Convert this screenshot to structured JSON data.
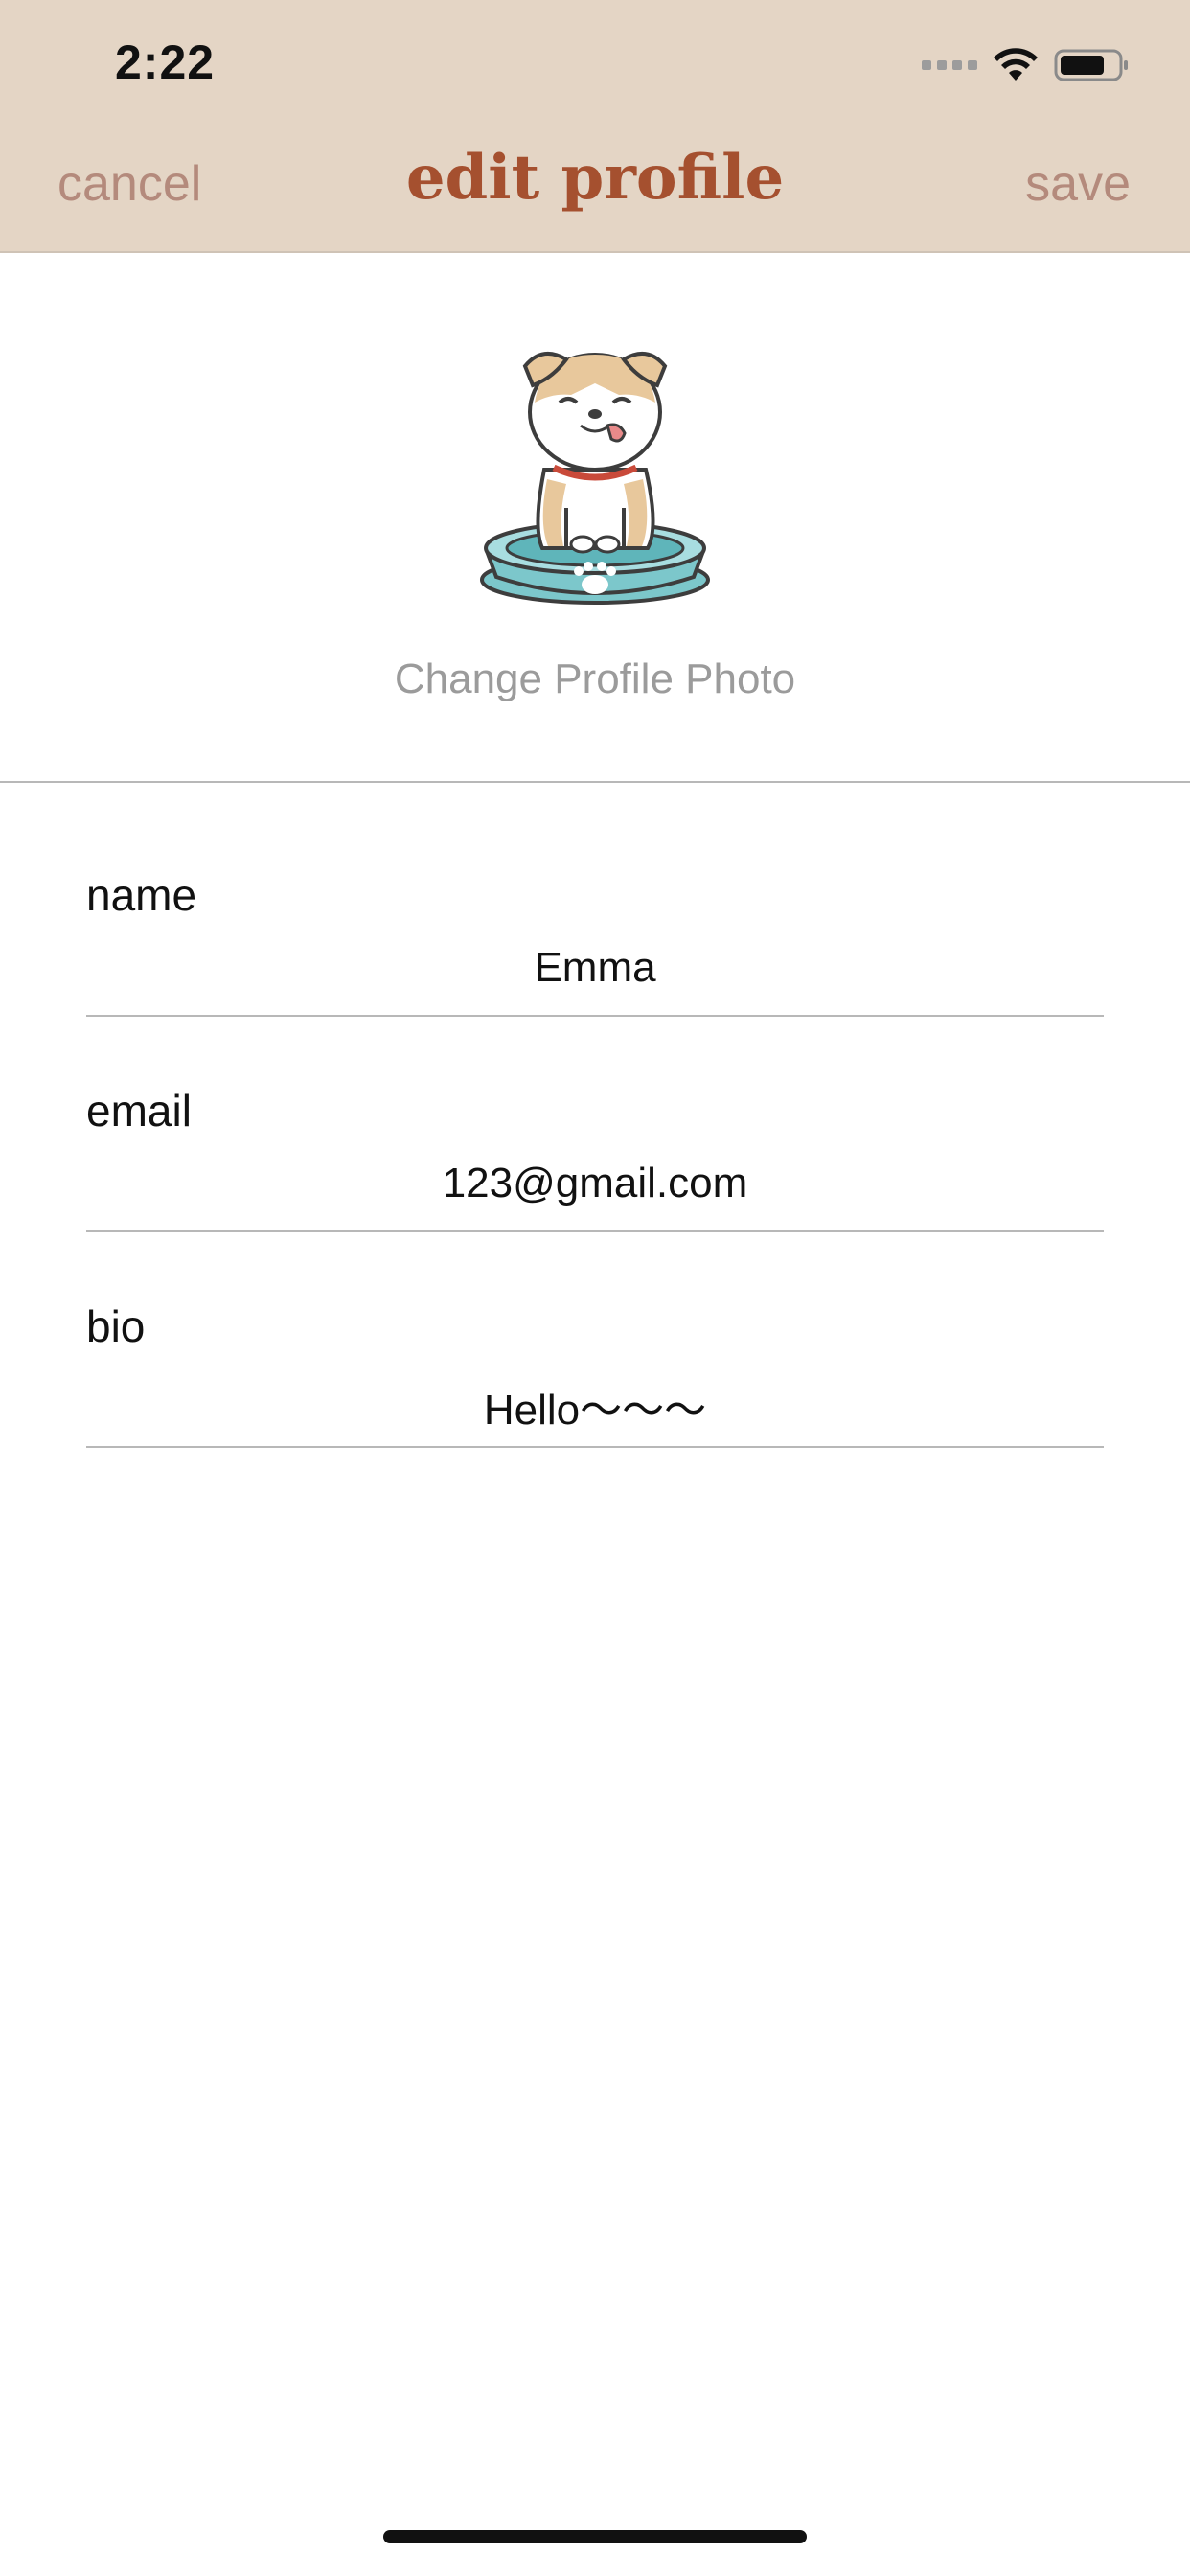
{
  "status_bar": {
    "time": "2:22"
  },
  "nav": {
    "cancel_label": "cancel",
    "title": "edit profile",
    "save_label": "save"
  },
  "profile": {
    "change_photo_label": "Change Profile Photo",
    "avatar_icon": "dog-in-bowl-illustration"
  },
  "fields": [
    {
      "label": "name",
      "value": "Emma"
    },
    {
      "label": "email",
      "value": "123@gmail.com"
    },
    {
      "label": "bio",
      "value": "Hello～～～"
    }
  ],
  "colors": {
    "header_bg": "#e4d5c5",
    "title": "#a5502f",
    "nav_button": "#b48a7c",
    "secondary_text": "#9b9b9b"
  }
}
